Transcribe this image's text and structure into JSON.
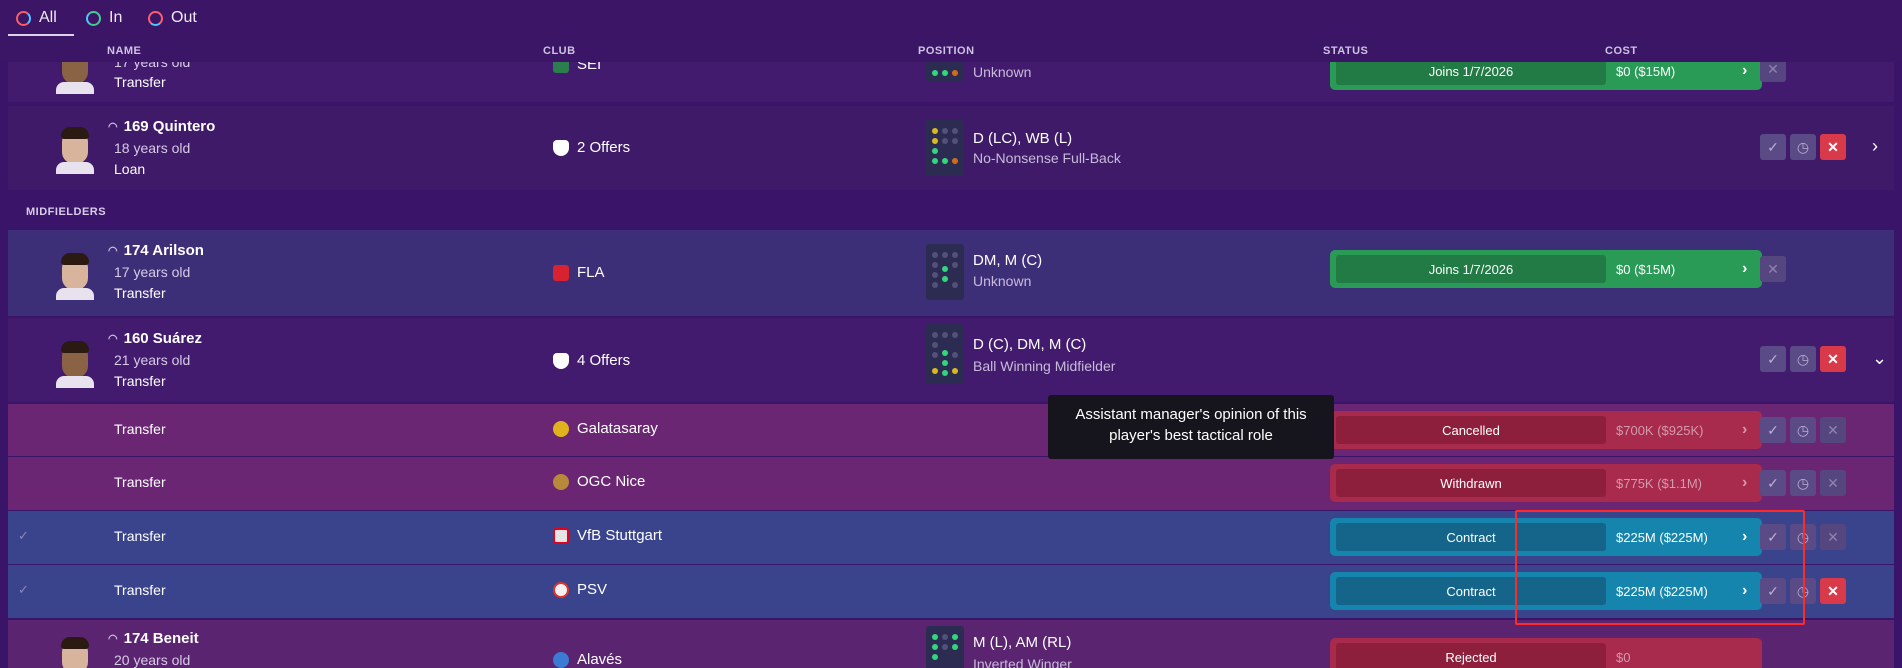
{
  "tabs": [
    {
      "label": "All",
      "icon": "swap-all-icon"
    },
    {
      "label": "In",
      "icon": "swap-in-icon"
    },
    {
      "label": "Out",
      "icon": "swap-out-icon"
    }
  ],
  "columns": {
    "name": "NAME",
    "club": "CLUB",
    "position": "POSITION",
    "status": "STATUS",
    "cost": "COST"
  },
  "section_midfielders": "MIDFIELDERS",
  "rows": {
    "r0": {
      "age": "17 years old",
      "type": "Transfer",
      "club": "SEI",
      "role": "Unknown",
      "status": "Joins 1/7/2026",
      "cost": "$0 ($15M)"
    },
    "r1": {
      "name": "169 Quintero",
      "age": "18 years old",
      "type": "Loan",
      "club": "2 Offers",
      "pos": "D (LC), WB (L)",
      "role": "No-Nonsense Full-Back"
    },
    "r2": {
      "name": "174 Arilson",
      "age": "17 years old",
      "type": "Transfer",
      "club": "FLA",
      "pos": "DM, M (C)",
      "role": "Unknown",
      "status": "Joins 1/7/2026",
      "cost": "$0 ($15M)"
    },
    "r3": {
      "name": "160 Suárez",
      "age": "21 years old",
      "type": "Transfer",
      "club": "4 Offers",
      "pos": "D (C), DM, M (C)",
      "role": "Ball Winning Midfielder"
    },
    "o1": {
      "type": "Transfer",
      "club": "Galatasaray",
      "status": "Cancelled",
      "cost": "$700K ($925K)"
    },
    "o2": {
      "type": "Transfer",
      "club": "OGC Nice",
      "status": "Withdrawn",
      "cost": "$775K ($1.1M)"
    },
    "o3": {
      "type": "Transfer",
      "club": "VfB Stuttgart",
      "status": "Contract",
      "cost": "$225M ($225M)"
    },
    "o4": {
      "type": "Transfer",
      "club": "PSV",
      "status": "Contract",
      "cost": "$225M ($225M)"
    },
    "r4": {
      "name": "174 Beneit",
      "age": "20 years old",
      "club": "Alavés",
      "pos": "M (L), AM (RL)",
      "role": "Inverted Winger",
      "status": "Rejected",
      "cost": "$0"
    }
  },
  "tooltip": {
    "line1": "Assistant manager's opinion of this",
    "line2": "player's best tactical role"
  },
  "colors": {
    "accent_green": "#2a9b57",
    "accent_red": "#a82a4c",
    "accent_cyan": "#1585ad",
    "highlight": "#ff2b2b"
  }
}
